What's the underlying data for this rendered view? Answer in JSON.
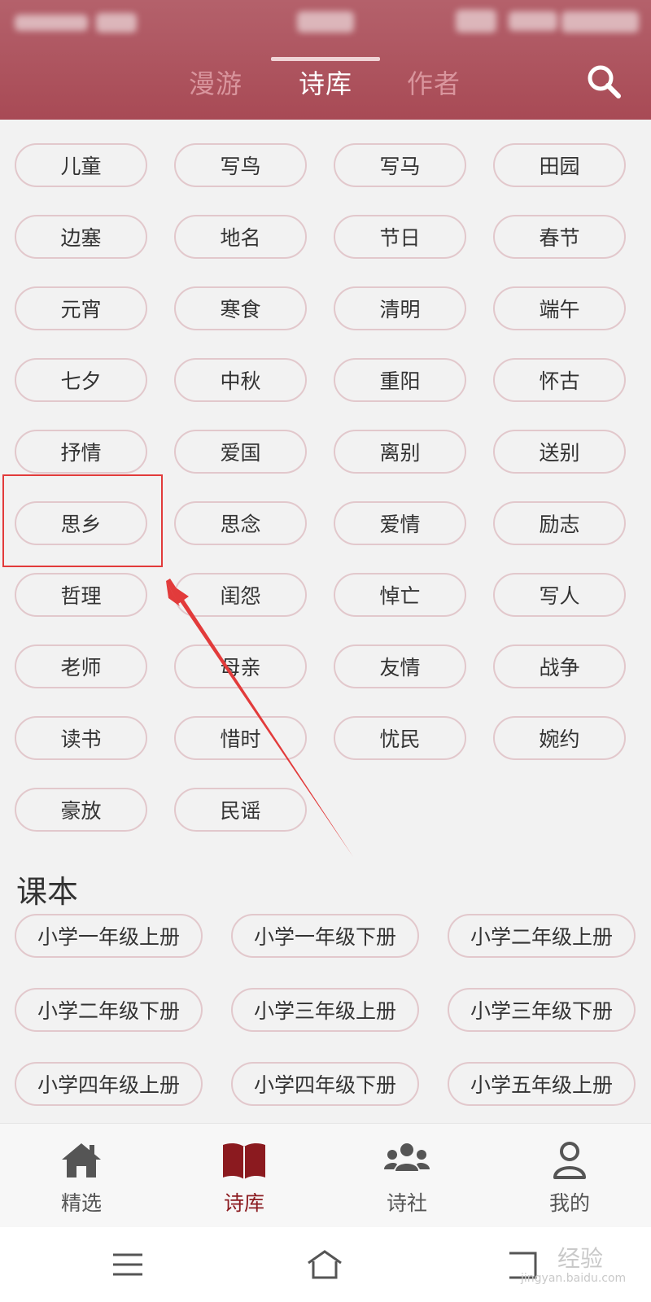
{
  "header": {
    "tabs": [
      {
        "label": "漫游",
        "active": false
      },
      {
        "label": "诗库",
        "active": true
      },
      {
        "label": "作者",
        "active": false
      }
    ],
    "search_icon": "search-icon"
  },
  "tags": [
    "儿童",
    "写鸟",
    "写马",
    "田园",
    "边塞",
    "地名",
    "节日",
    "春节",
    "元宵",
    "寒食",
    "清明",
    "端午",
    "七夕",
    "中秋",
    "重阳",
    "怀古",
    "抒情",
    "爱国",
    "离别",
    "送别",
    "思乡",
    "思念",
    "爱情",
    "励志",
    "哲理",
    "闺怨",
    "悼亡",
    "写人",
    "老师",
    "母亲",
    "友情",
    "战争",
    "读书",
    "惜时",
    "忧民",
    "婉约",
    "豪放",
    "民谣"
  ],
  "textbook": {
    "title": "课本",
    "items": [
      "小学一年级上册",
      "小学一年级下册",
      "小学二年级上册",
      "小学二年级下册",
      "小学三年级上册",
      "小学三年级下册",
      "小学四年级上册",
      "小学四年级下册",
      "小学五年级上册"
    ]
  },
  "bottom_nav": [
    {
      "label": "精选",
      "icon": "home-icon",
      "active": false
    },
    {
      "label": "诗库",
      "icon": "book-icon",
      "active": true
    },
    {
      "label": "诗社",
      "icon": "people-icon",
      "active": false
    },
    {
      "label": "我的",
      "icon": "user-icon",
      "active": false
    }
  ],
  "system_bar": [
    "menu-icon",
    "home-outline-icon",
    "back-icon"
  ],
  "watermark": {
    "text": "经验",
    "sub": "jingyan.baidu.com"
  },
  "colors": {
    "header": "#a84a55",
    "tag_border": "#e2c8cc",
    "active_nav": "#8b1a1f",
    "annotation": "#e23b3b"
  }
}
